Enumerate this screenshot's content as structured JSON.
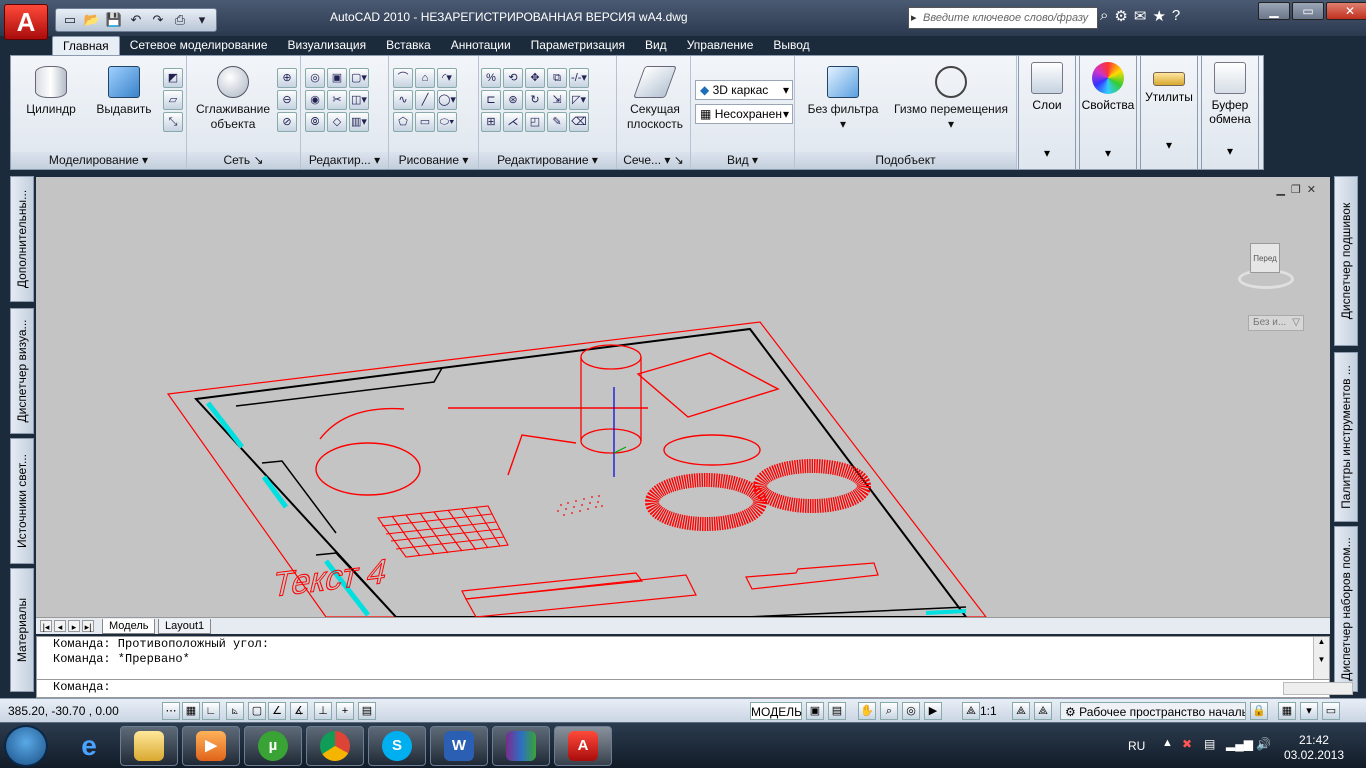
{
  "title": {
    "app_title": "AutoCAD 2010 - НЕЗАРЕГИСТРИРОВАННАЯ ВЕРСИЯ    wA4.dwg",
    "search_placeholder": "Введите ключевое слово/фразу"
  },
  "tabs": [
    "Главная",
    "Сетевое моделирование",
    "Визуализация",
    "Вставка",
    "Аннотации",
    "Параметризация",
    "Вид",
    "Управление",
    "Вывод"
  ],
  "ribbon": {
    "cylinder": "Цилиндр",
    "extrude": "Выдавить",
    "smooth": "Сглаживание объекта",
    "section": "Секущая плоскость",
    "visual_style": "3D каркас",
    "view_saved": "Несохранен",
    "no_filter": "Без фильтра",
    "gizmo": "Гизмо перемещения",
    "layers": "Слои",
    "properties": "Свойства",
    "utilities": "Утилиты",
    "clipboard": "Буфер обмена",
    "panels": {
      "modeling": "Моделирование",
      "mesh": "Сеть",
      "edit": "Редактир...",
      "draw": "Рисование",
      "modify": "Редактирование",
      "section": "Сече...",
      "view": "Вид",
      "subobject": "Подобъект"
    }
  },
  "left_palettes": [
    "Дополнительны...",
    "Диспетчер визуа...",
    "Источники свет...",
    "Материалы"
  ],
  "right_palettes": [
    "Диспетчер подшивок",
    "Палитры инструментов ...",
    "Диспетчер наборов пом..."
  ],
  "viewcube": {
    "face": "Перед",
    "nav_label": "Без и..."
  },
  "drawing": {
    "text_label": "Текст 4"
  },
  "layout_tabs": [
    "Модель",
    "Layout1"
  ],
  "command": {
    "lines": [
      "Команда: Противоположный угол:",
      "Команда: *Прервано*"
    ],
    "prompt": "Команда:"
  },
  "status": {
    "coords": "385.20, -30.70 , 0.00",
    "model": "МОДЕЛЬ",
    "scale": "1:1",
    "workspace": "Рабочее пространство начальн"
  },
  "taskbar": {
    "lang": "RU",
    "time": "21:42",
    "date": "03.02.2013"
  },
  "colors": {
    "drawing_red": "#ff0000",
    "viewport_bg": "#c4c4c4",
    "cyan": "#00e0e0"
  }
}
